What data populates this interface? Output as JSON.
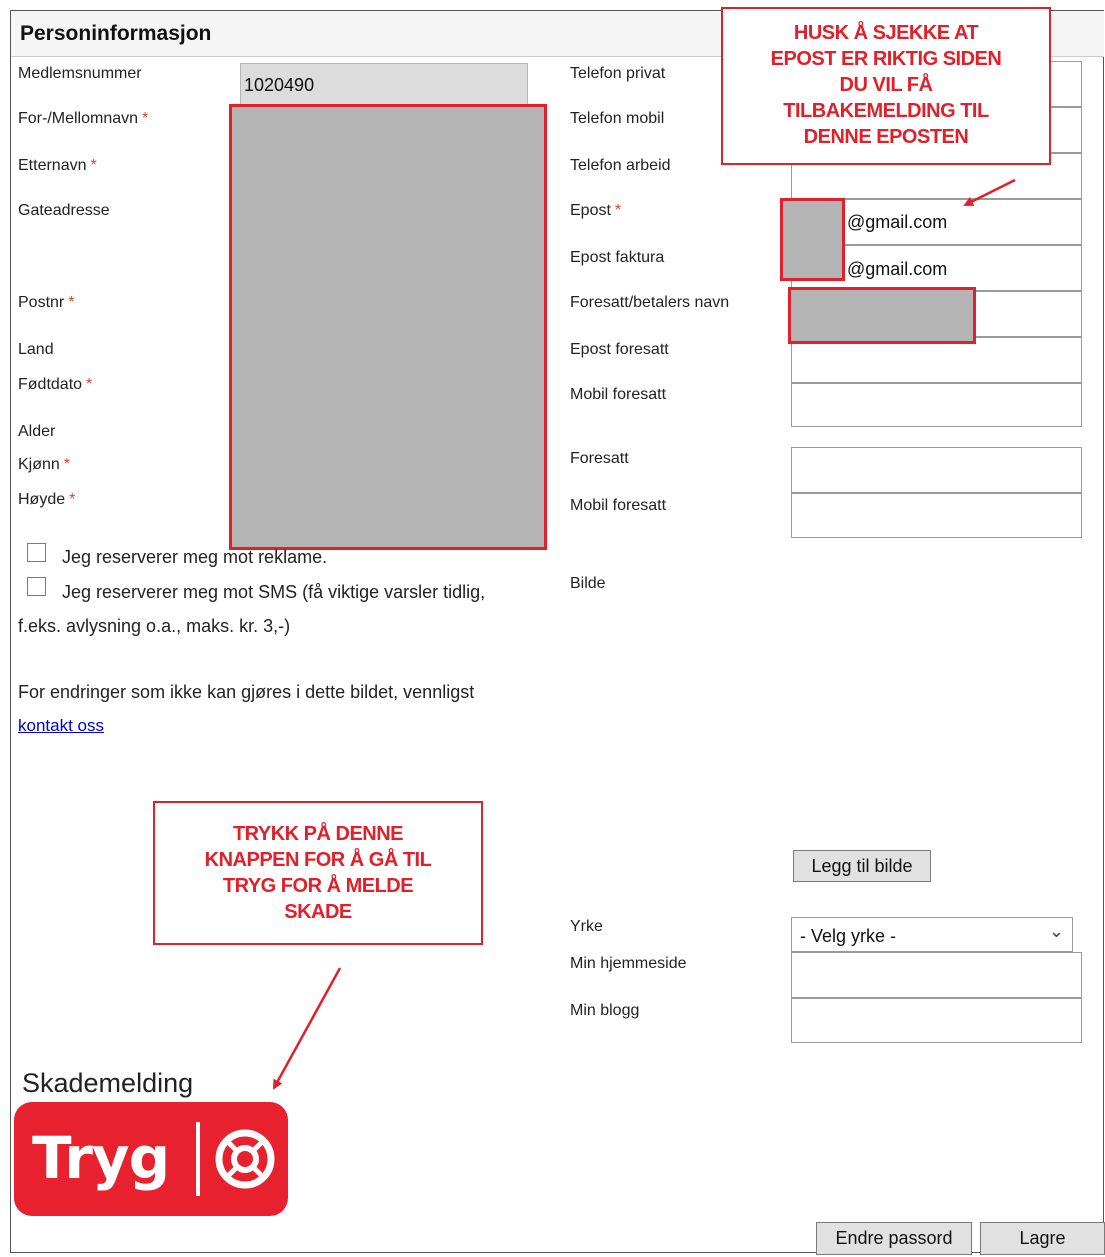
{
  "header": {
    "title": "Personinformasjon"
  },
  "left_labels": {
    "medlemsnummer": "Medlemsnummer",
    "fornavn": "For-/Mellomnavn",
    "etternavn": "Etternavn",
    "gateadresse": "Gateadresse",
    "postnr": "Postnr",
    "land": "Land",
    "fodtdato": "Fødtdato",
    "alder": "Alder",
    "kjonn": "Kjønn",
    "hoyde": "Høyde"
  },
  "required_marker": "*",
  "fields": {
    "medlemsnummer_value": "1020490"
  },
  "right_labels": {
    "telefon_privat": "Telefon privat",
    "telefon_mobil": "Telefon mobil",
    "telefon_arbeid": "Telefon arbeid",
    "epost": "Epost",
    "epost_faktura": "Epost faktura",
    "foresatt_navn": "Foresatt/betalers navn",
    "epost_foresatt": "Epost foresatt",
    "mobil_foresatt": "Mobil foresatt",
    "foresatt": "Foresatt",
    "mobil_foresatt2": "Mobil foresatt",
    "bilde": "Bilde",
    "yrke": "Yrke",
    "hjemmeside": "Min hjemmeside",
    "blogg": "Min blogg"
  },
  "email_suffix": "@gmail.com",
  "email_faktura_suffix": "@gmail.com",
  "checkboxes": {
    "reklame": "Jeg reserverer meg mot reklame.",
    "sms": "Jeg reserverer meg mot SMS (få viktige varsler tidlig,",
    "sms_cont": "f.eks. avlysning o.a., maks. kr. 3,-)"
  },
  "notice": {
    "text": "For endringer som ikke kan gjøres i dette bildet, vennligst",
    "link": "kontakt oss"
  },
  "buttons": {
    "add_image": "Legg til bilde",
    "change_password": "Endre passord",
    "save": "Lagre"
  },
  "yrke_select": {
    "selected": "- Velg yrke -"
  },
  "annotations": {
    "email_note": [
      "HUSK Å SJEKKE AT",
      "EPOST ER RIKTIG SIDEN",
      "DU VIL FÅ",
      "TILBAKEMELDING TIL",
      "DENNE EPOSTEN"
    ],
    "tryg_note": [
      "TRYKK PÅ DENNE",
      "KNAPPEN FOR Å GÅ TIL",
      "TRYG FOR Å MELDE",
      "SKADE"
    ]
  },
  "skademelding": {
    "label": "Skademelding",
    "logo_text": "Tryg"
  },
  "colors": {
    "annotation_red": "#e0202a",
    "tryg_red": "#e8212e",
    "required": "#e0402a",
    "link": "#0000cc"
  },
  "icons": {
    "lifebuoy": "lifebuoy-icon",
    "chevron": "chevron-down-icon",
    "arrow": "arrow-icon"
  }
}
